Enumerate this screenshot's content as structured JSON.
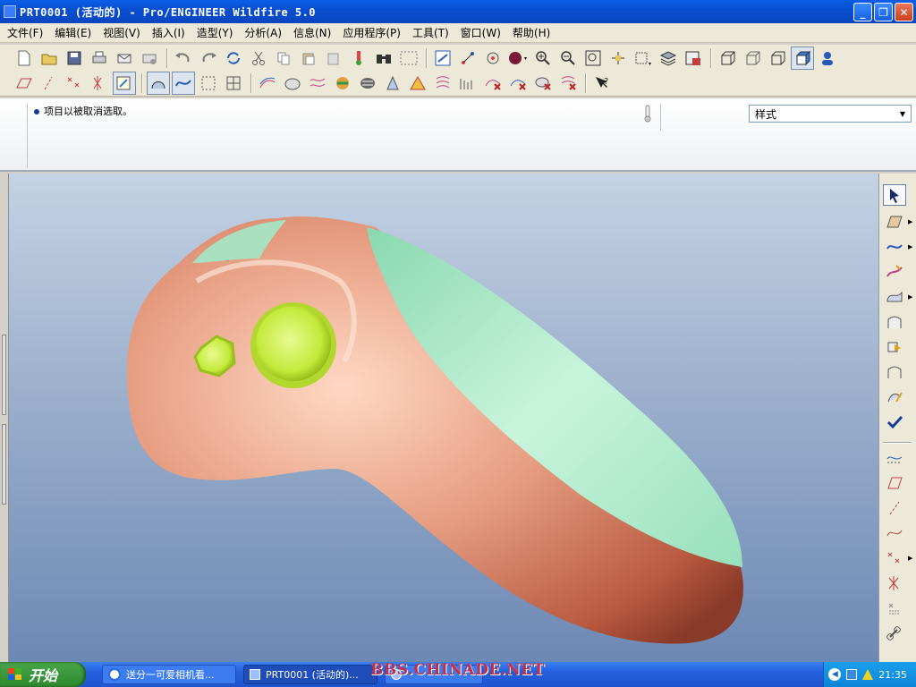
{
  "window": {
    "title": "PRT0001 (活动的) - Pro/ENGINEER Wildfire 5.0"
  },
  "menu": [
    "文件(F)",
    "编辑(E)",
    "视图(V)",
    "插入(I)",
    "造型(Y)",
    "分析(A)",
    "信息(N)",
    "应用程序(P)",
    "工具(T)",
    "窗口(W)",
    "帮助(H)"
  ],
  "message": {
    "text": "项目以被取消选取。"
  },
  "filter": {
    "value": "样式"
  },
  "taskbar": {
    "start_label": "开始",
    "tasks": [
      {
        "label": "送分一可爱相机看..."
      },
      {
        "label": "PRT0001 (活动的)..."
      }
    ],
    "clock": "21:35"
  },
  "watermark": "BBS.CHINADE.NET",
  "colors": {
    "model_copper": "#e29a7e",
    "model_green": "#a8e6c4",
    "button_lime": "#c4ea3c"
  }
}
